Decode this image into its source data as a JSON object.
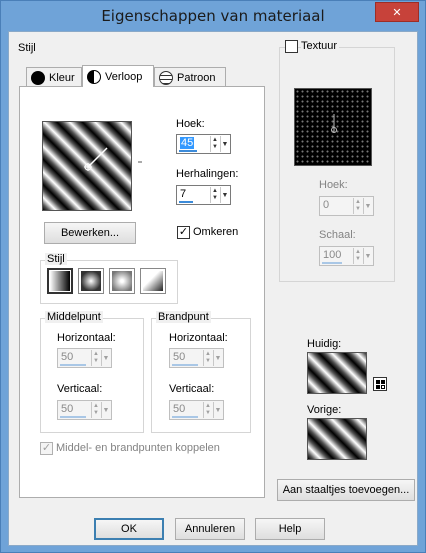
{
  "window": {
    "title": "Eigenschappen van materiaal",
    "close_glyph": "✕"
  },
  "style_group": {
    "caption": "Stijl"
  },
  "tabs": [
    {
      "label": "Kleur",
      "icon": "circle-icon"
    },
    {
      "label": "Verloop",
      "icon": "gradient-icon"
    },
    {
      "label": "Patroon",
      "icon": "grid-globe-icon"
    }
  ],
  "angle": {
    "label": "Hoek:",
    "value": "45"
  },
  "repeats": {
    "label": "Herhalingen:",
    "value": "7"
  },
  "edit_button": {
    "label": "Bewerken..."
  },
  "invert": {
    "label": "Omkeren",
    "checked": true
  },
  "gradient_style": {
    "caption": "Stijl",
    "options": [
      "linear",
      "rectangular",
      "sunburst",
      "radial"
    ],
    "selected_index": 0
  },
  "center": {
    "caption": "Middelpunt",
    "horizontal_label": "Horizontaal:",
    "horizontal_value": "50",
    "vertical_label": "Verticaal:",
    "vertical_value": "50"
  },
  "focal": {
    "caption": "Brandpunt",
    "horizontal_label": "Horizontaal:",
    "horizontal_value": "50",
    "vertical_label": "Verticaal:",
    "vertical_value": "50"
  },
  "link_points": {
    "label": "Middel- en brandpunten koppelen",
    "checked": true
  },
  "texture": {
    "label": "Textuur",
    "checked": false,
    "angle_label": "Hoek:",
    "angle_value": "0",
    "scale_label": "Schaal:",
    "scale_value": "100"
  },
  "current": {
    "label": "Huidig:"
  },
  "previous": {
    "label": "Vorige:"
  },
  "add_swatch_button": {
    "label": "Aan staaltjes toevoegen..."
  },
  "footer": {
    "ok": "OK",
    "cancel": "Annuleren",
    "help": "Help"
  },
  "colors": {
    "accent": "#3c8bd9",
    "title_bg": "#6fa3d8",
    "close_bg": "#c7423a"
  }
}
